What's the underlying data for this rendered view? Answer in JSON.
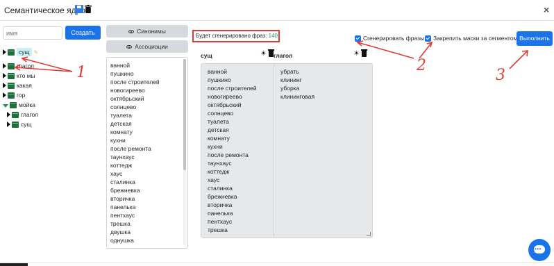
{
  "header": {
    "title": "Семантическое ядро",
    "save_icon": "save-icon",
    "trash_icon": "trash-icon",
    "close_label": "×"
  },
  "left": {
    "name_placeholder": "имя",
    "create_label": "Создать",
    "tree": [
      {
        "label": "сущ",
        "selected": true,
        "expanded": false
      },
      {
        "label": "глагол",
        "expanded": false
      },
      {
        "label": "кто мы",
        "expanded": false
      },
      {
        "label": "какая",
        "expanded": false
      },
      {
        "label": "гор",
        "expanded": false
      },
      {
        "label": "мойка",
        "expanded": true
      },
      {
        "label": "глагол",
        "expanded": false,
        "child": true
      },
      {
        "label": "сущ",
        "expanded": false,
        "child": true
      }
    ]
  },
  "middle": {
    "synonyms_label": "Синонимы",
    "associations_label": "Ассоциации",
    "words": [
      "ванной",
      "пушкино",
      "после строителей",
      "новогиреево",
      "октябрьский",
      "солнцево",
      "туалета",
      "детская",
      "комнату",
      "кухни",
      "после ремонта",
      "таунхаус",
      "коттедж",
      "хаус",
      "сталинка",
      "брежневка",
      "вторичка",
      "панелька",
      "пентхаус",
      "трешка",
      "двушка",
      "однушка"
    ]
  },
  "count": {
    "label": "Будет сгенерировано фраз:",
    "value": "140"
  },
  "columns": [
    {
      "title": "сущ",
      "words": [
        "ванной",
        "пушкино",
        "после строителей",
        "новогиреево",
        "октябрьский",
        "солнцево",
        "туалета",
        "детская",
        "комнату",
        "кухни",
        "после ремонта",
        "таунхаус",
        "коттедж",
        "хаус",
        "сталинка",
        "брежневка",
        "вторичка",
        "панелька",
        "пентхаус",
        "трешка"
      ]
    },
    {
      "title": "глагол",
      "words": [
        "убрать",
        "клининг",
        "уборка",
        "клининговая"
      ]
    }
  ],
  "options": {
    "generate_label": "Сгенерировать фразы",
    "generate_checked": true,
    "lock_label": "Закрепить маски за сегментом",
    "lock_checked": true
  },
  "run_label": "Выполнить",
  "annotations": [
    "1",
    "2",
    "3"
  ],
  "colors": {
    "accent": "#1a73e8",
    "annotation": "#e53935",
    "count_value": "#2e8b57",
    "folder": "#1e6e3c",
    "selected_bg": "#c9f0f5"
  }
}
